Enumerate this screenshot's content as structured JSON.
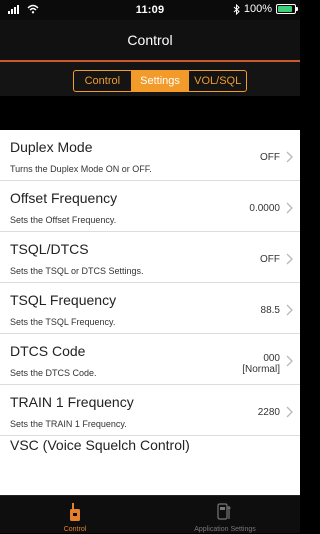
{
  "status_bar": {
    "time": "11:09",
    "battery": "100%",
    "battery_level": 1.0,
    "icons": [
      "signal-icon",
      "wifi-icon",
      "bluetooth-icon",
      "battery-icon"
    ]
  },
  "nav": {
    "title": "Control"
  },
  "segments": [
    {
      "label": "Control",
      "active": false
    },
    {
      "label": "Settings",
      "active": true
    },
    {
      "label": "VOL/SQL",
      "active": false
    }
  ],
  "settings": [
    {
      "title": "Duplex Mode",
      "description": "Turns the Duplex Mode ON or OFF.",
      "value": "OFF"
    },
    {
      "title": "Offset Frequency",
      "description": "Sets the Offset Frequency.",
      "value": "0.0000"
    },
    {
      "title": "TSQL/DTCS",
      "description": "Sets the TSQL or DTCS Settings.",
      "value": "OFF"
    },
    {
      "title": "TSQL Frequency",
      "description": "Sets the TSQL Frequency.",
      "value": "88.5"
    },
    {
      "title": "DTCS Code",
      "description": "Sets the DTCS Code.",
      "value": "000",
      "value_sub": "[Normal]"
    },
    {
      "title": "TRAIN 1 Frequency",
      "description": "Sets the TRAIN 1 Frequency.",
      "value": "2280"
    },
    {
      "title": "VSC (Voice Squelch Control)"
    }
  ],
  "tab_bar": {
    "items": [
      {
        "label": "Control",
        "icon": "radio-icon",
        "active": true
      },
      {
        "label": "Application Settings",
        "icon": "settings-device-icon",
        "active": false
      }
    ]
  },
  "colors": {
    "accent": "#F29B2B",
    "nav_divider": "#C85A2C",
    "tab_active": "#E5812A"
  }
}
